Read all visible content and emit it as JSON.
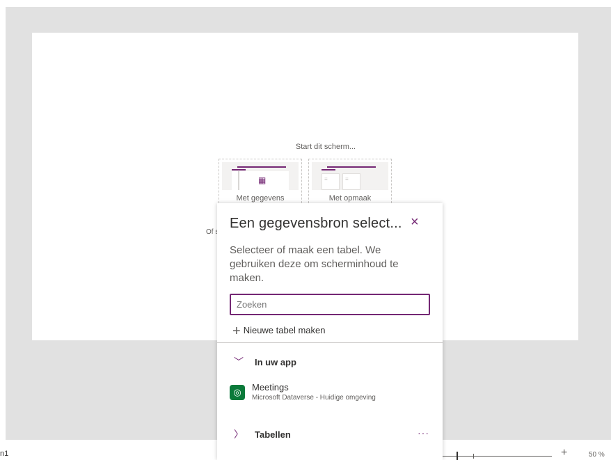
{
  "canvas": {
    "start_label": "Start dit scherm...",
    "layout_options": [
      {
        "label": "Met gegevens",
        "icon": "table-grid-icon"
      },
      {
        "label": "Met opmaak",
        "icon": "layout-panels-icon"
      }
    ],
    "or_label": "Of s"
  },
  "bottom_bar": {
    "screen_name": "n1",
    "zoom_plus": "+",
    "zoom_value": "50 %"
  },
  "flyout": {
    "title": "Een gegevensbron select...",
    "close_icon": "×",
    "description": "Selecteer of maak een tabel. We gebruiken deze om scherminhoud te maken.",
    "search_placeholder": "Zoeken",
    "new_table_label": "Nieuwe tabel maken",
    "sections": [
      {
        "label": "In uw app",
        "expanded": true
      },
      {
        "label": "Tabellen",
        "expanded": false
      }
    ],
    "items": [
      {
        "name": "Meetings",
        "source": "Microsoft Dataverse - Huidige omgeving",
        "icon": "dataverse-icon"
      }
    ],
    "more_label": "···"
  },
  "colors": {
    "accent": "#742774",
    "dataverse": "#0b7a3a",
    "canvas_bg": "#e1e1e1"
  }
}
